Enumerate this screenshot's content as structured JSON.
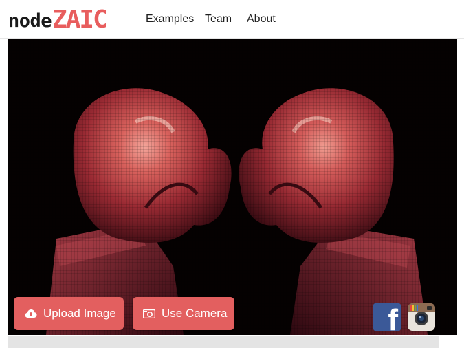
{
  "header": {
    "logo_part1": "node",
    "logo_part2": "ZAIC",
    "nav": [
      "Examples",
      "Team",
      "About"
    ]
  },
  "actions": {
    "upload_label": "Upload Image",
    "camera_label": "Use Camera"
  },
  "icons": {
    "upload": "cloud-upload-icon",
    "camera": "camera-icon",
    "facebook": "facebook-icon",
    "instagram": "instagram-icon"
  },
  "social": {
    "facebook_glyph": "f"
  },
  "colors": {
    "accent": "#e35f5f",
    "logo_accent": "#e85d5d",
    "image_background": "#050101",
    "facebook": "#3b5998"
  }
}
